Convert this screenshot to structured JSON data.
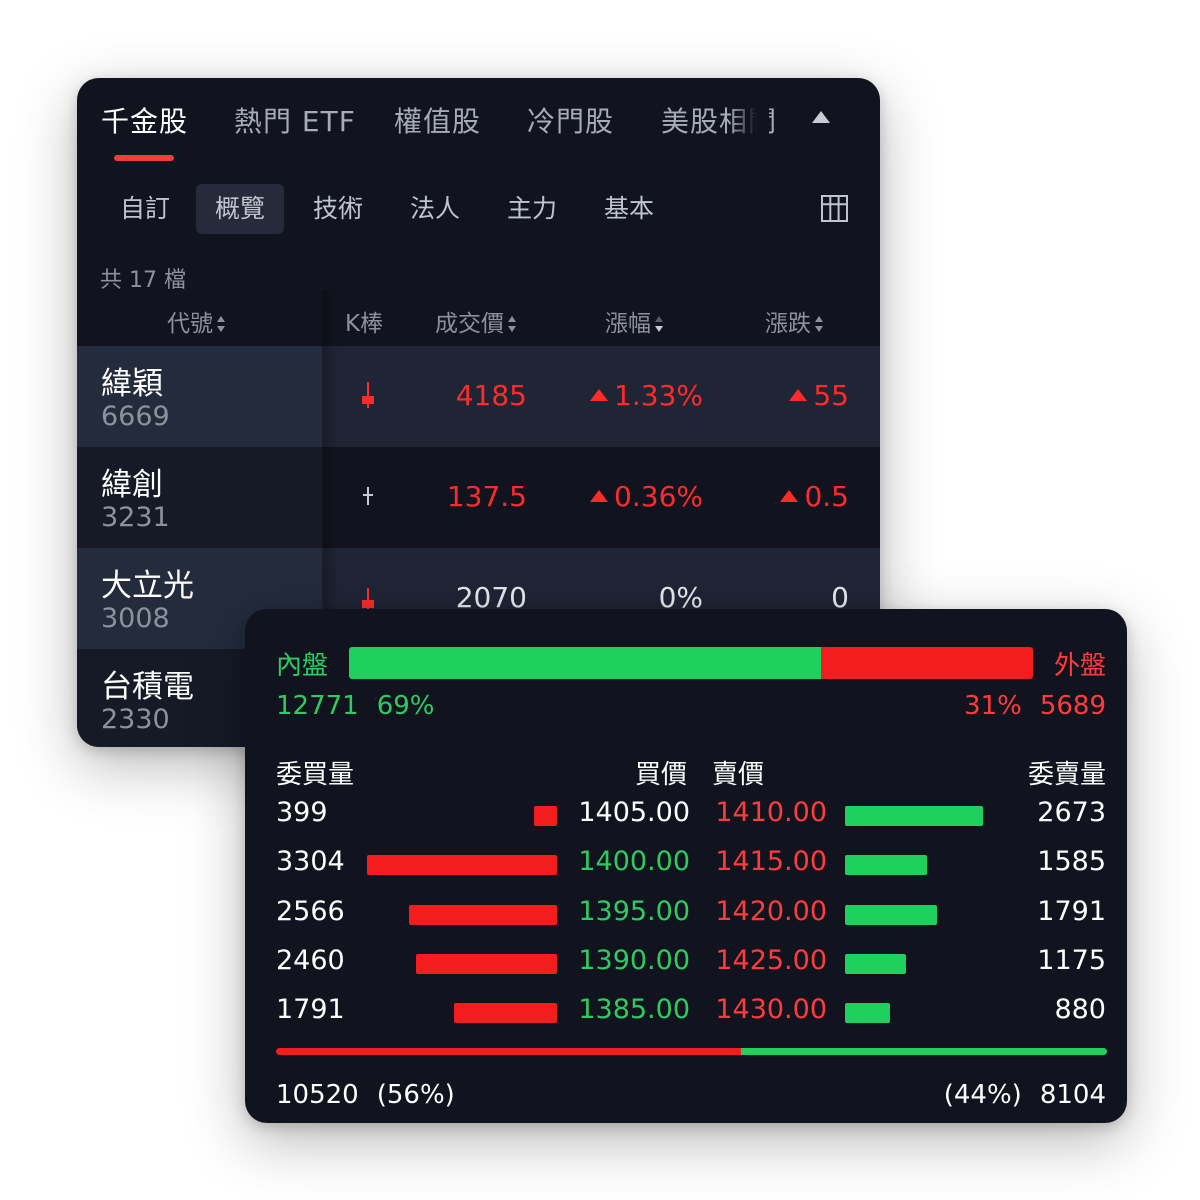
{
  "list": {
    "tabs": [
      "千金股",
      "熱門 ETF",
      "權值股",
      "冷門股",
      "美股相關"
    ],
    "active_tab": 0,
    "subtabs": [
      "自訂",
      "概覽",
      "技術",
      "法人",
      "主力",
      "基本"
    ],
    "active_subtab": 1,
    "count_text": "共 17 檔",
    "columns": {
      "code": "代號",
      "kbar": "K棒",
      "price": "成交價",
      "change_pct": "漲幅",
      "change": "漲跌"
    },
    "rows": [
      {
        "name": "緯穎",
        "code": "6669",
        "price": "4185",
        "change_pct": "1.33%",
        "change": "55",
        "direction": "up"
      },
      {
        "name": "緯創",
        "code": "3231",
        "price": "137.5",
        "change_pct": "0.36%",
        "change": "0.5",
        "direction": "up"
      },
      {
        "name": "大立光",
        "code": "3008",
        "price": "2070",
        "change_pct": "0%",
        "change": "0",
        "direction": "flat"
      },
      {
        "name": "台積電",
        "code": "2330",
        "price": "",
        "change_pct": "",
        "change": "",
        "direction": "flat"
      }
    ]
  },
  "book": {
    "inner_label": "內盤",
    "outer_label": "外盤",
    "inner_volume": "12771",
    "inner_pct": "69%",
    "outer_pct": "31%",
    "outer_volume": "5689",
    "inner_ratio": 0.69,
    "headers": {
      "bid_volume": "委買量",
      "bid_price": "買價",
      "ask_price": "賣價",
      "ask_volume": "委賣量"
    },
    "levels": [
      {
        "bid_volume": "399",
        "bid_price": "1405.00",
        "ask_price": "1410.00",
        "ask_volume": "2673",
        "bid_price_color": "white"
      },
      {
        "bid_volume": "3304",
        "bid_price": "1400.00",
        "ask_price": "1415.00",
        "ask_volume": "1585",
        "bid_price_color": "green"
      },
      {
        "bid_volume": "2566",
        "bid_price": "1395.00",
        "ask_price": "1420.00",
        "ask_volume": "1791",
        "bid_price_color": "green"
      },
      {
        "bid_volume": "2460",
        "bid_price": "1390.00",
        "ask_price": "1425.00",
        "ask_volume": "1175",
        "bid_price_color": "green"
      },
      {
        "bid_volume": "1791",
        "bid_price": "1385.00",
        "ask_price": "1430.00",
        "ask_volume": "880",
        "bid_price_color": "green"
      }
    ],
    "total_bid_volume": "10520",
    "total_bid_pct": "(56%)",
    "total_ask_pct": "(44%)",
    "total_ask_volume": "8104",
    "bid_ratio": 0.56
  },
  "colors": {
    "up": "#ff2a2a",
    "down": "#1fd05f",
    "background": "#11141f",
    "tab_accent": "#f23d3d"
  }
}
